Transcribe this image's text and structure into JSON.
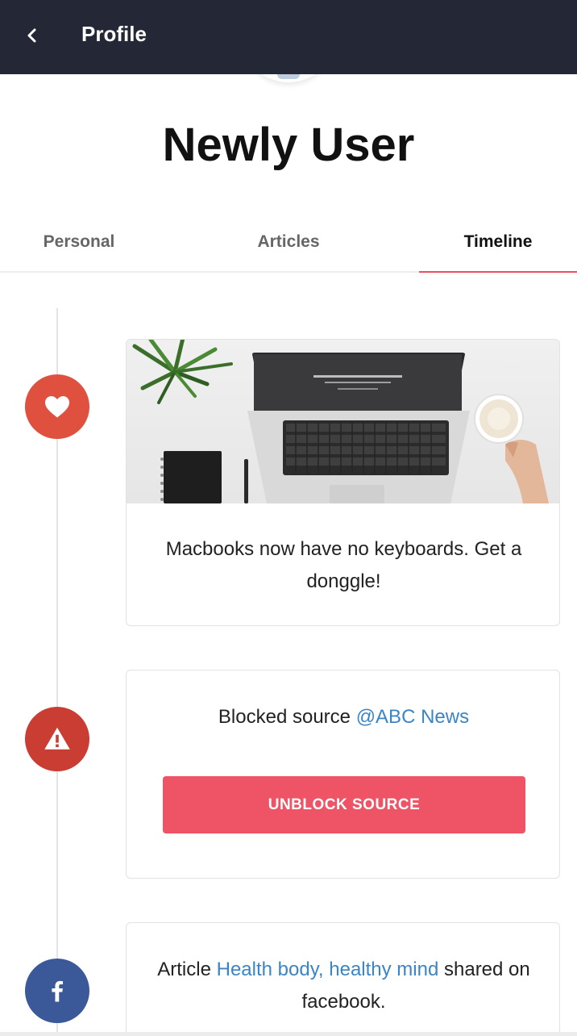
{
  "header": {
    "title": "Profile",
    "back_icon": "chevron-left-icon"
  },
  "profile": {
    "name": "Newly User"
  },
  "tabs": [
    {
      "label": "Personal",
      "active": false
    },
    {
      "label": "Articles",
      "active": false
    },
    {
      "label": "Timeline",
      "active": true
    }
  ],
  "accent_color": "#ef5466",
  "timeline": [
    {
      "icon": "heart-icon",
      "icon_color": "#e0503f",
      "image": "laptop-desk-photo",
      "text": "Macbooks now have no keyboards. Get a donggle!"
    },
    {
      "icon": "warning-icon",
      "icon_color": "#c93d33",
      "text_prefix": "Blocked source ",
      "link": "@ABC News",
      "button_label": "UNBLOCK SOURCE"
    },
    {
      "icon": "facebook-icon",
      "icon_color": "#3b5998",
      "text_prefix": "Article ",
      "link": "Health body, healthy mind",
      "text_suffix": " shared on facebook."
    }
  ]
}
